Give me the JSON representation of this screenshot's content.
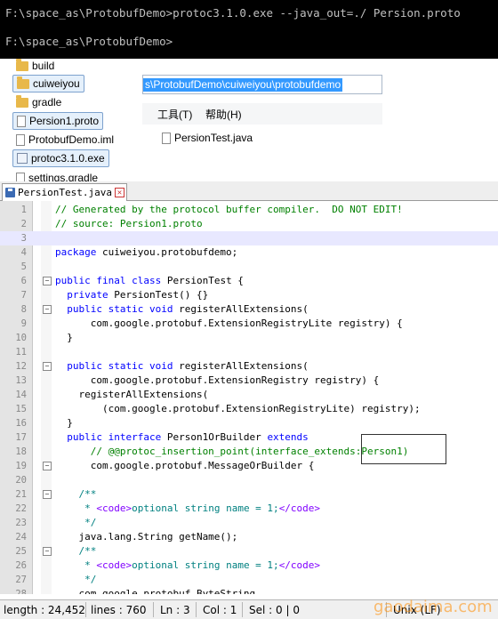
{
  "console": {
    "line1": "F:\\space_as\\ProtobufDemo>protoc3.1.0.exe --java_out=./ Persion.proto",
    "line2": "F:\\space_as\\ProtobufDemo>"
  },
  "explorer": {
    "items": [
      {
        "label": "build",
        "icon": "folder-icon"
      },
      {
        "label": "cuiweiyou",
        "icon": "folder-icon"
      },
      {
        "label": "gradle",
        "icon": "folder-icon"
      },
      {
        "label": "Persion1.proto",
        "icon": "document-icon"
      },
      {
        "label": "ProtobufDemo.iml",
        "icon": "document-icon"
      },
      {
        "label": "protoc3.1.0.exe",
        "icon": "exe-icon"
      },
      {
        "label": "settings.gradle",
        "icon": "document-icon"
      }
    ],
    "address": "s\\ProtobufDemo\\cuiweiyou\\protobufdemo",
    "menu": [
      "工具(T)",
      "帮助(H)"
    ],
    "pane_file": "PersionTest.java"
  },
  "editor": {
    "tab_label": "PersionTest.java",
    "lines": [
      {
        "n": "1",
        "fold": "",
        "segs": [
          [
            "cm",
            "// Generated by the protocol buffer compiler.  DO NOT EDIT!"
          ]
        ]
      },
      {
        "n": "2",
        "fold": "",
        "segs": [
          [
            "cm",
            "// source: Persion1.proto"
          ]
        ]
      },
      {
        "n": "3",
        "fold": "",
        "hl": true,
        "segs": []
      },
      {
        "n": "4",
        "fold": "",
        "segs": [
          [
            "kw",
            "package"
          ],
          [
            "dk",
            " cuiweiyou.protobufdemo;"
          ]
        ]
      },
      {
        "n": "5",
        "fold": "",
        "segs": []
      },
      {
        "n": "6",
        "fold": "−",
        "segs": [
          [
            "kw",
            "public final class"
          ],
          [
            "dk",
            " PersionTest {"
          ]
        ]
      },
      {
        "n": "7",
        "fold": "",
        "segs": [
          [
            "kw",
            "  private"
          ],
          [
            "dk",
            " PersionTest() {}"
          ]
        ]
      },
      {
        "n": "8",
        "fold": "−",
        "segs": [
          [
            "kw",
            "  public static void"
          ],
          [
            "dk",
            " registerAllExtensions("
          ]
        ]
      },
      {
        "n": "9",
        "fold": "",
        "segs": [
          [
            "dk",
            "      com.google.protobuf.ExtensionRegistryLite registry) {"
          ]
        ]
      },
      {
        "n": "10",
        "fold": "",
        "segs": [
          [
            "dk",
            "  }"
          ]
        ]
      },
      {
        "n": "11",
        "fold": "",
        "segs": []
      },
      {
        "n": "12",
        "fold": "−",
        "segs": [
          [
            "kw",
            "  public static void"
          ],
          [
            "dk",
            " registerAllExtensions("
          ]
        ]
      },
      {
        "n": "13",
        "fold": "",
        "segs": [
          [
            "dk",
            "      com.google.protobuf.ExtensionRegistry registry) {"
          ]
        ]
      },
      {
        "n": "14",
        "fold": "",
        "segs": [
          [
            "dk",
            "    registerAllExtensions("
          ]
        ]
      },
      {
        "n": "15",
        "fold": "",
        "segs": [
          [
            "dk",
            "        (com.google.protobuf.ExtensionRegistryLite) registry);"
          ]
        ]
      },
      {
        "n": "16",
        "fold": "",
        "segs": [
          [
            "dk",
            "  }"
          ]
        ]
      },
      {
        "n": "17",
        "fold": "",
        "segs": [
          [
            "kw",
            "  public interface"
          ],
          [
            "dk",
            " Person1OrBuilder "
          ],
          [
            "kw",
            "extends"
          ]
        ]
      },
      {
        "n": "18",
        "fold": "",
        "segs": [
          [
            "cm",
            "      // @@protoc_insertion_point(interface_extends:Person1)"
          ]
        ]
      },
      {
        "n": "19",
        "fold": "−",
        "segs": [
          [
            "dk",
            "      com.google.protobuf.MessageOrBuilder {"
          ]
        ]
      },
      {
        "n": "20",
        "fold": "",
        "segs": []
      },
      {
        "n": "21",
        "fold": "−",
        "segs": [
          [
            "ct",
            "    /**"
          ]
        ]
      },
      {
        "n": "22",
        "fold": "",
        "segs": [
          [
            "ct",
            "     * "
          ],
          [
            "st",
            "<code>"
          ],
          [
            "ct",
            "optional string name = 1;"
          ],
          [
            "st",
            "</code>"
          ]
        ]
      },
      {
        "n": "23",
        "fold": "",
        "segs": [
          [
            "ct",
            "     */"
          ]
        ]
      },
      {
        "n": "24",
        "fold": "",
        "segs": [
          [
            "dk",
            "    java.lang.String getName();"
          ]
        ]
      },
      {
        "n": "25",
        "fold": "−",
        "segs": [
          [
            "ct",
            "    /**"
          ]
        ]
      },
      {
        "n": "26",
        "fold": "",
        "segs": [
          [
            "ct",
            "     * "
          ],
          [
            "st",
            "<code>"
          ],
          [
            "ct",
            "optional string name = 1;"
          ],
          [
            "st",
            "</code>"
          ]
        ]
      },
      {
        "n": "27",
        "fold": "",
        "segs": [
          [
            "ct",
            "     */"
          ]
        ]
      },
      {
        "n": "28",
        "fold": "",
        "segs": [
          [
            "dk",
            "    com.google.protobuf.ByteString"
          ]
        ]
      }
    ]
  },
  "status": {
    "length": "length : 24,452",
    "lines": "lines : 760",
    "ln": "Ln : 3",
    "col": "Col : 1",
    "sel": "Sel : 0 | 0",
    "eol": "Unix (LF)"
  },
  "watermark": "gaodaima.com"
}
